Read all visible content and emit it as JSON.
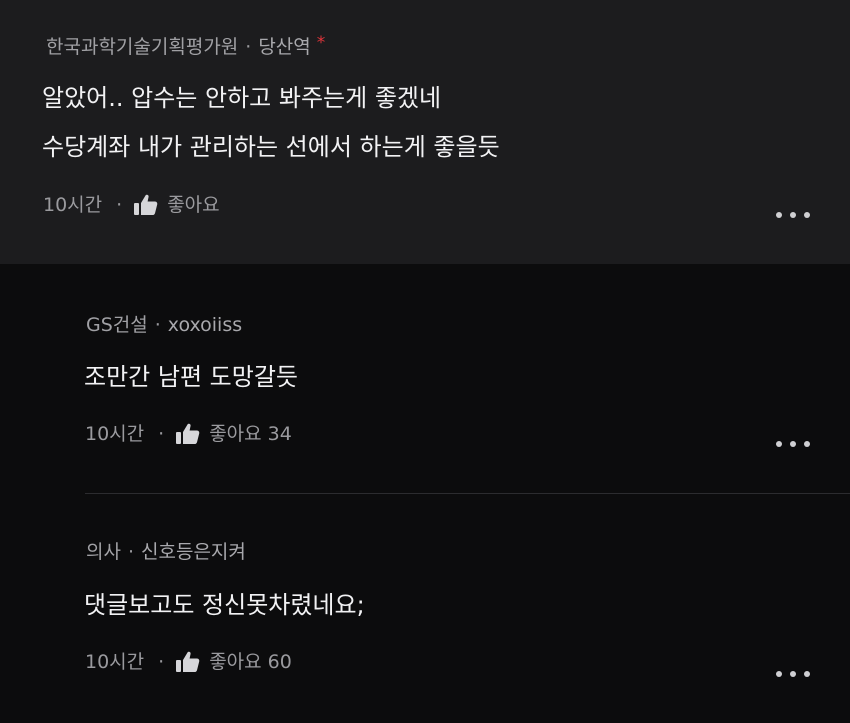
{
  "comments": [
    {
      "company": "한국과학기술기획평가원",
      "separator": "·",
      "nickname": "당산역",
      "author_mark": "*",
      "lines": [
        "알았어.. 압수는 안하고 봐주는게 좋겠네",
        "수당계좌 내가 관리하는 선에서 하는게 좋을듯"
      ],
      "time": "10시간",
      "like_label": "좋아요",
      "like_count": ""
    },
    {
      "company": "GS건설",
      "separator": "·",
      "nickname": "xoxoiiss",
      "lines": [
        "조만간 남편 도망갈듯"
      ],
      "time": "10시간",
      "like_label": "좋아요",
      "like_count": "34"
    },
    {
      "company": "의사",
      "separator": "·",
      "nickname": "신호등은지켜",
      "lines": [
        "댓글보고도 정신못차렸네요;"
      ],
      "time": "10시간",
      "like_label": "좋아요",
      "like_count": "60"
    }
  ],
  "icons": {
    "like": "thumbs-up-icon",
    "more": "more-horizontal-icon"
  },
  "colors": {
    "top_comment_bg": "#1c1c1e",
    "page_bg": "#0c0c0d",
    "author_mark": "#e0353b"
  }
}
